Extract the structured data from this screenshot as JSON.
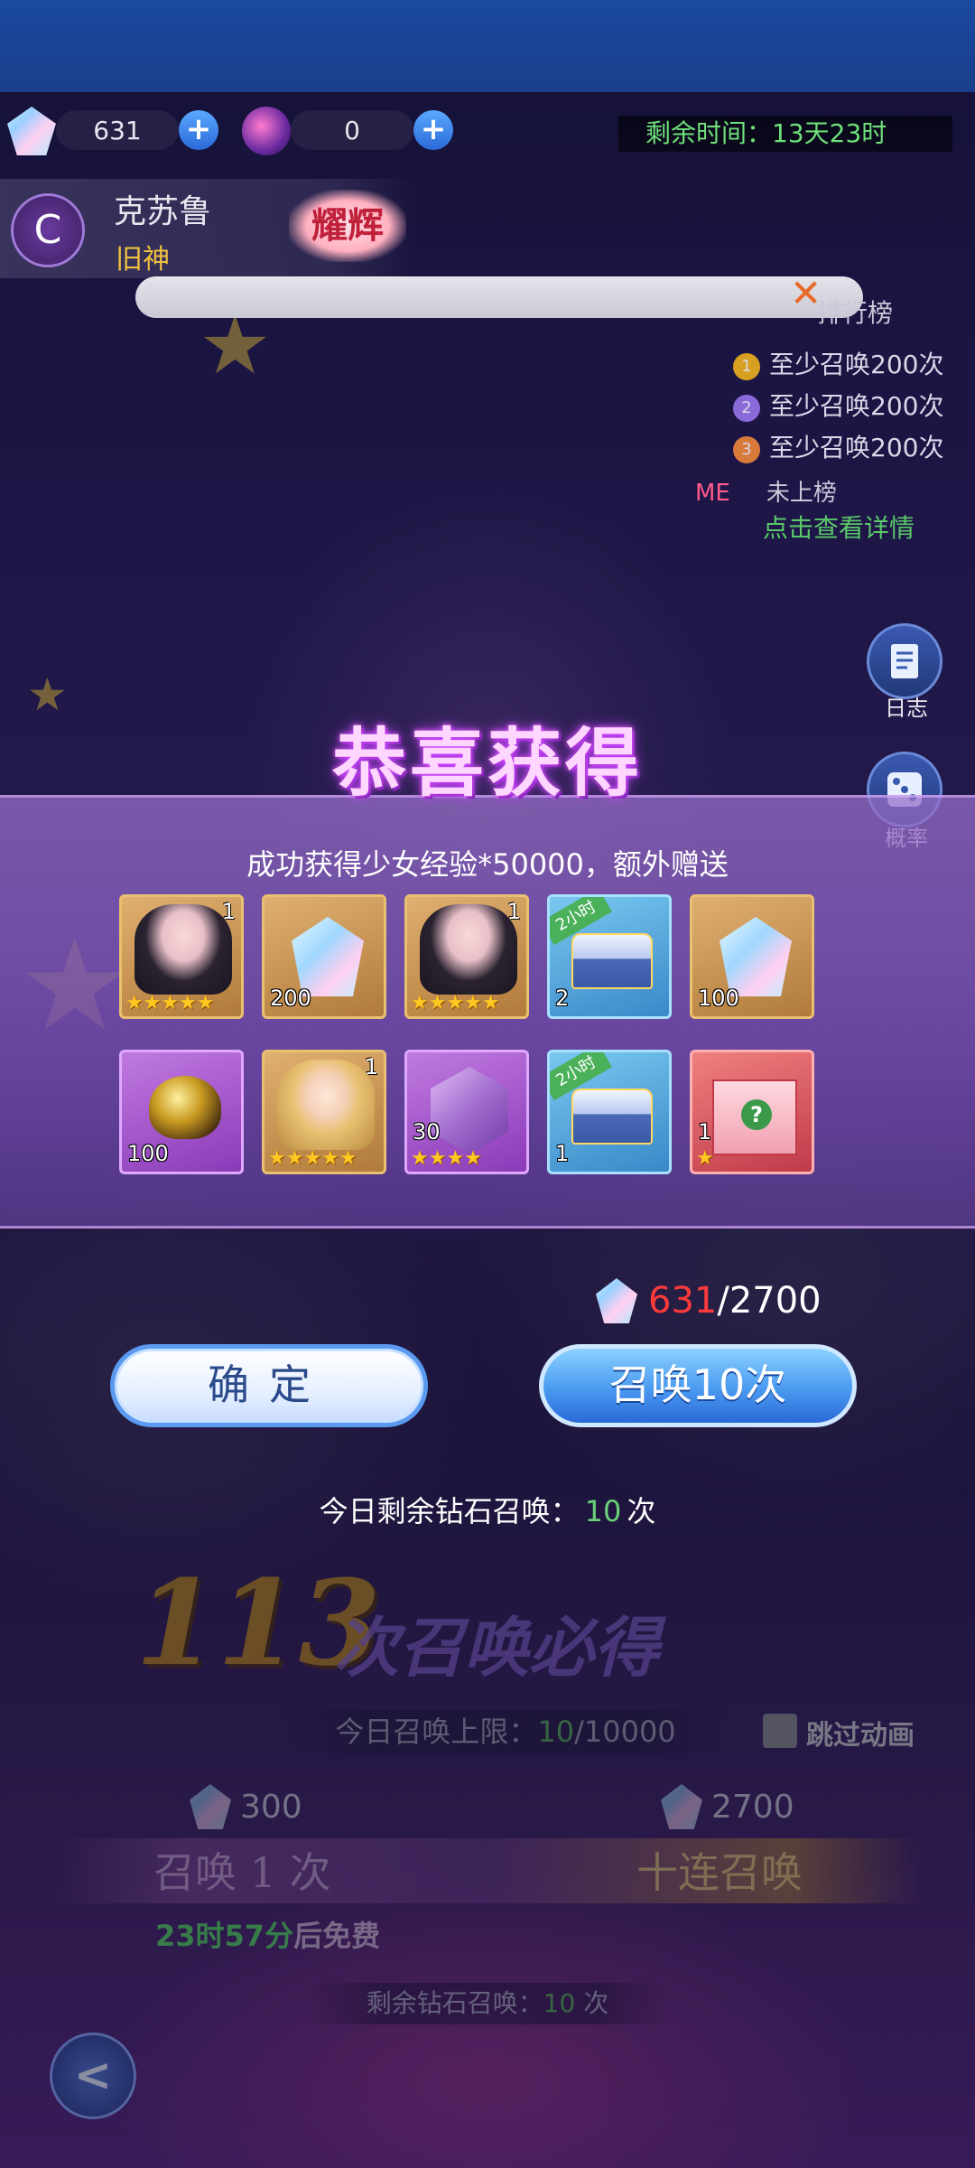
{
  "currency": {
    "gems": "631",
    "orbs": "0",
    "plus": "+"
  },
  "timer": "剩余时间：13天23时",
  "character": {
    "emblem": "C",
    "name": "克苏鲁",
    "title": "旧神",
    "badge": "耀辉"
  },
  "banner": {
    "close": "✕"
  },
  "ranking": {
    "title": "排行榜",
    "rows": [
      {
        "rank": "1",
        "text": "至少召唤200次",
        "color": "#d8a020"
      },
      {
        "rank": "2",
        "text": "至少召唤200次",
        "color": "#8a6ad8"
      },
      {
        "rank": "3",
        "text": "至少召唤200次",
        "color": "#d87a3a"
      }
    ],
    "me_label": "ME",
    "me_value": "未上榜",
    "detail_link": "点击查看详情"
  },
  "side": {
    "log_label": "日志",
    "prob_label": "概率"
  },
  "modal": {
    "title": "恭喜获得",
    "message": "成功获得少女经验*50000，额外赠送",
    "items": [
      {
        "kind": "portrait-dark",
        "corner": "1",
        "stars": "★★★★★",
        "count": ""
      },
      {
        "kind": "crystal",
        "corner": "",
        "stars": "",
        "count": "200"
      },
      {
        "kind": "portrait-dark",
        "corner": "1",
        "stars": "★★★★★",
        "count": ""
      },
      {
        "kind": "chest",
        "corner": "",
        "stars": "",
        "count": "2",
        "tag": "2小时"
      },
      {
        "kind": "crystal",
        "corner": "",
        "stars": "",
        "count": "100"
      },
      {
        "kind": "egg",
        "corner": "",
        "stars": "",
        "count": "100"
      },
      {
        "kind": "portrait-blonde",
        "corner": "1",
        "stars": "★★★★★",
        "count": ""
      },
      {
        "kind": "shard",
        "corner": "",
        "stars": "★★★★",
        "count": "30"
      },
      {
        "kind": "chest",
        "corner": "",
        "stars": "",
        "count": "1",
        "tag": "2小时"
      },
      {
        "kind": "gift",
        "corner": "",
        "stars": "★",
        "count": "1"
      }
    ],
    "cost_have": "631",
    "cost_need": "/2700",
    "confirm_label": "确定",
    "summon10_label": "召唤10次",
    "remain_prefix": "今日剩余钻石召唤：",
    "remain_value": "10",
    "remain_suffix": "次"
  },
  "background": {
    "guarantee_number": "113",
    "guarantee_text": "次召唤必得",
    "limit_prefix": "今日召唤上限：",
    "limit_value": "10",
    "limit_total": "/10000",
    "skip_label": "跳过动画",
    "price_single": "300",
    "price_ten": "2700",
    "summon_single": "召唤 1 次",
    "summon_ten": "十连召唤",
    "free_time": "23时57分",
    "free_suffix": "后免费",
    "bottom_remain_prefix": "剩余钻石召唤：",
    "bottom_remain_value": "10",
    "bottom_remain_suffix": "次",
    "back_icon": "<"
  }
}
